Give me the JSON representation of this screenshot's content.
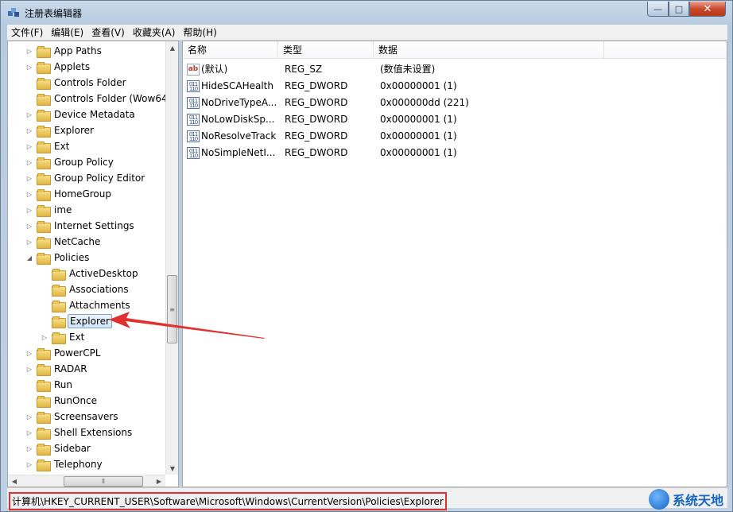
{
  "window": {
    "title": "注册表编辑器",
    "minimize": "—",
    "maximize": "□",
    "close": "✕"
  },
  "menu": [
    "文件(F)",
    "编辑(E)",
    "查看(V)",
    "收藏夹(A)",
    "帮助(H)"
  ],
  "tree": [
    {
      "label": "App Paths",
      "indent": 0,
      "expander": "collapsed"
    },
    {
      "label": "Applets",
      "indent": 0,
      "expander": "collapsed"
    },
    {
      "label": "Controls Folder",
      "indent": 0,
      "expander": "none"
    },
    {
      "label": "Controls Folder (Wow64",
      "indent": 0,
      "expander": "none"
    },
    {
      "label": "Device Metadata",
      "indent": 0,
      "expander": "collapsed"
    },
    {
      "label": "Explorer",
      "indent": 0,
      "expander": "collapsed"
    },
    {
      "label": "Ext",
      "indent": 0,
      "expander": "collapsed"
    },
    {
      "label": "Group Policy",
      "indent": 0,
      "expander": "collapsed"
    },
    {
      "label": "Group Policy Editor",
      "indent": 0,
      "expander": "collapsed"
    },
    {
      "label": "HomeGroup",
      "indent": 0,
      "expander": "collapsed"
    },
    {
      "label": "ime",
      "indent": 0,
      "expander": "collapsed"
    },
    {
      "label": "Internet Settings",
      "indent": 0,
      "expander": "collapsed"
    },
    {
      "label": "NetCache",
      "indent": 0,
      "expander": "collapsed"
    },
    {
      "label": "Policies",
      "indent": 0,
      "expander": "expanded"
    },
    {
      "label": "ActiveDesktop",
      "indent": 1,
      "expander": "none"
    },
    {
      "label": "Associations",
      "indent": 1,
      "expander": "none"
    },
    {
      "label": "Attachments",
      "indent": 1,
      "expander": "none"
    },
    {
      "label": "Explorer",
      "indent": 1,
      "expander": "none",
      "selected": true
    },
    {
      "label": "Ext",
      "indent": 1,
      "expander": "collapsed"
    },
    {
      "label": "PowerCPL",
      "indent": 0,
      "expander": "collapsed"
    },
    {
      "label": "RADAR",
      "indent": 0,
      "expander": "collapsed"
    },
    {
      "label": "Run",
      "indent": 0,
      "expander": "none"
    },
    {
      "label": "RunOnce",
      "indent": 0,
      "expander": "none"
    },
    {
      "label": "Screensavers",
      "indent": 0,
      "expander": "collapsed"
    },
    {
      "label": "Shell Extensions",
      "indent": 0,
      "expander": "collapsed"
    },
    {
      "label": "Sidebar",
      "indent": 0,
      "expander": "collapsed"
    },
    {
      "label": "Telephony",
      "indent": 0,
      "expander": "collapsed"
    }
  ],
  "columns": [
    "名称",
    "类型",
    "数据"
  ],
  "values": [
    {
      "icon": "string-value-icon",
      "name": "(默认)",
      "type": "REG_SZ",
      "data": "(数值未设置)"
    },
    {
      "icon": "binary-value-icon",
      "name": "HideSCAHealth",
      "type": "REG_DWORD",
      "data": "0x00000001 (1)"
    },
    {
      "icon": "binary-value-icon",
      "name": "NoDriveTypeA...",
      "type": "REG_DWORD",
      "data": "0x000000dd (221)"
    },
    {
      "icon": "binary-value-icon",
      "name": "NoLowDiskSp...",
      "type": "REG_DWORD",
      "data": "0x00000001 (1)"
    },
    {
      "icon": "binary-value-icon",
      "name": "NoResolveTrack",
      "type": "REG_DWORD",
      "data": "0x00000001 (1)"
    },
    {
      "icon": "binary-value-icon",
      "name": "NoSimpleNetI...",
      "type": "REG_DWORD",
      "data": "0x00000001 (1)"
    }
  ],
  "status": {
    "path": "计算机\\HKEY_CURRENT_USER\\Software\\Microsoft\\Windows\\CurrentVersion\\Policies\\Explorer"
  },
  "watermark": {
    "text": "系统天地"
  },
  "colors": {
    "highlight_border": "#e03030",
    "selection": "#d3e6fb",
    "arrow": "#e03030"
  }
}
